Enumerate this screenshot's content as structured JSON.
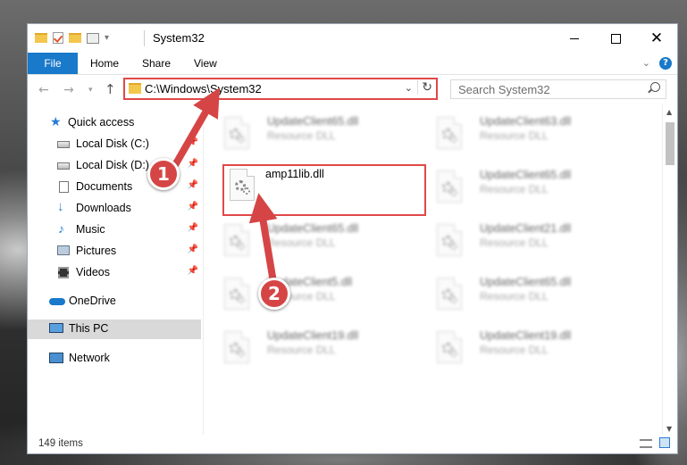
{
  "window": {
    "title": "System32",
    "controls": {
      "minimize_icon": "minimize-icon",
      "maximize_icon": "maximize-icon",
      "close_icon": "close-icon"
    }
  },
  "ribbon": {
    "tabs": [
      {
        "label": "File",
        "active": true
      },
      {
        "label": "Home"
      },
      {
        "label": "Share"
      },
      {
        "label": "View"
      }
    ],
    "accent_color": "#1979ca"
  },
  "address_bar": {
    "path": "C:\\Windows\\System32",
    "search_placeholder": "Search System32"
  },
  "sidebar": {
    "items": [
      {
        "label": "Quick access",
        "icon": "star-icon"
      },
      {
        "label": "Local Disk (C:)",
        "icon": "drive-icon",
        "pinned": true
      },
      {
        "label": "Local Disk (D:)",
        "icon": "drive-icon",
        "pinned": true
      },
      {
        "label": "Documents",
        "icon": "documents-icon",
        "pinned": true
      },
      {
        "label": "Downloads",
        "icon": "downloads-icon",
        "pinned": true
      },
      {
        "label": "Music",
        "icon": "music-icon",
        "pinned": true
      },
      {
        "label": "Pictures",
        "icon": "pictures-icon",
        "pinned": true
      },
      {
        "label": "Videos",
        "icon": "videos-icon",
        "pinned": true
      },
      {
        "label": "OneDrive",
        "icon": "onedrive-icon"
      },
      {
        "label": "This PC",
        "icon": "this-pc-icon",
        "selected": true
      },
      {
        "label": "Network",
        "icon": "network-icon"
      }
    ]
  },
  "files": [
    {
      "name": "UpdateClient65.dll",
      "type": "Resource DLL"
    },
    {
      "name": "UpdateClient63.dll",
      "type": "Resource DLL"
    },
    {
      "name": "amp11lib.dll",
      "type": "",
      "highlighted": true
    },
    {
      "name": "UpdateClient65.dll",
      "type": "Resource DLL"
    },
    {
      "name": "UpdateClient65.dll",
      "type": "Resource DLL"
    },
    {
      "name": "UpdateClient21.dll",
      "type": "Resource DLL"
    },
    {
      "name": "UpdateClient5.dll",
      "type": "Resource DLL"
    },
    {
      "name": "UpdateClient65.dll",
      "type": "Resource DLL"
    },
    {
      "name": "UpdateClient19.dll",
      "type": "Resource DLL"
    },
    {
      "name": "UpdateClient19.dll",
      "type": "Resource DLL"
    }
  ],
  "status": {
    "item_count": "149 items"
  },
  "annotations": [
    {
      "number": "1",
      "target": "address-bar"
    },
    {
      "number": "2",
      "target": "amp11lib.dll"
    }
  ],
  "annotation_color": "#d64545"
}
